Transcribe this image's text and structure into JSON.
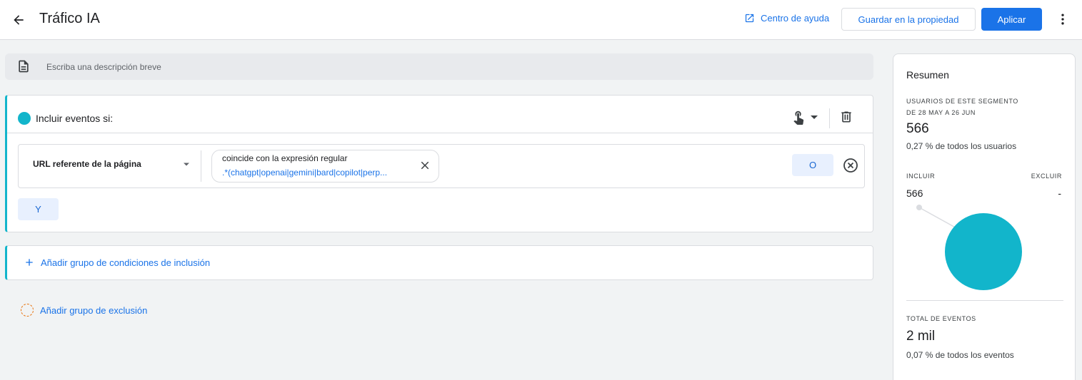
{
  "header": {
    "title": "Tráfico IA",
    "help_label": "Centro de ayuda",
    "save_label": "Guardar en la propiedad",
    "apply_label": "Aplicar"
  },
  "description": {
    "placeholder": "Escriba una descripción breve"
  },
  "include_group": {
    "title": "Incluir eventos si:",
    "condition": {
      "dimension": "URL referente de la página",
      "operator": "coincide con la expresión regular",
      "value": ".*(chatgpt|openai|gemini|bard|copilot|perp..."
    },
    "or_label": "O",
    "and_label": "Y"
  },
  "add_inclusion_group_label": "Añadir grupo de condiciones de inclusión",
  "add_exclusion_group_label": "Añadir grupo de exclusión",
  "summary": {
    "title": "Resumen",
    "users_label_line1": "USUARIOS DE ESTE SEGMENTO",
    "users_label_line2": "DE 28 MAY A 26 JUN",
    "users_value": "566",
    "users_pct": "0,27 % de todos los usuarios",
    "include_label": "INCLUIR",
    "exclude_label": "EXCLUIR",
    "include_value": "566",
    "exclude_value": "-",
    "include_share": 1.0,
    "events_label": "TOTAL DE EVENTOS",
    "events_value": "2 mil",
    "events_pct": "0,07 % de todos los eventos"
  },
  "colors": {
    "accent": "#1a73e8",
    "segment": "#12b5cb",
    "exclusion": "#e8710a"
  },
  "icons": {
    "back": "arrow-left-icon",
    "help": "open-in-new-icon",
    "more": "more-vert-icon",
    "description": "document-icon",
    "scope": "touch-hand-icon",
    "delete": "trash-icon",
    "dropdown": "caret-down-icon",
    "chip_close": "close-icon",
    "remove_condition": "cancel-circle-icon",
    "add": "plus-icon"
  }
}
